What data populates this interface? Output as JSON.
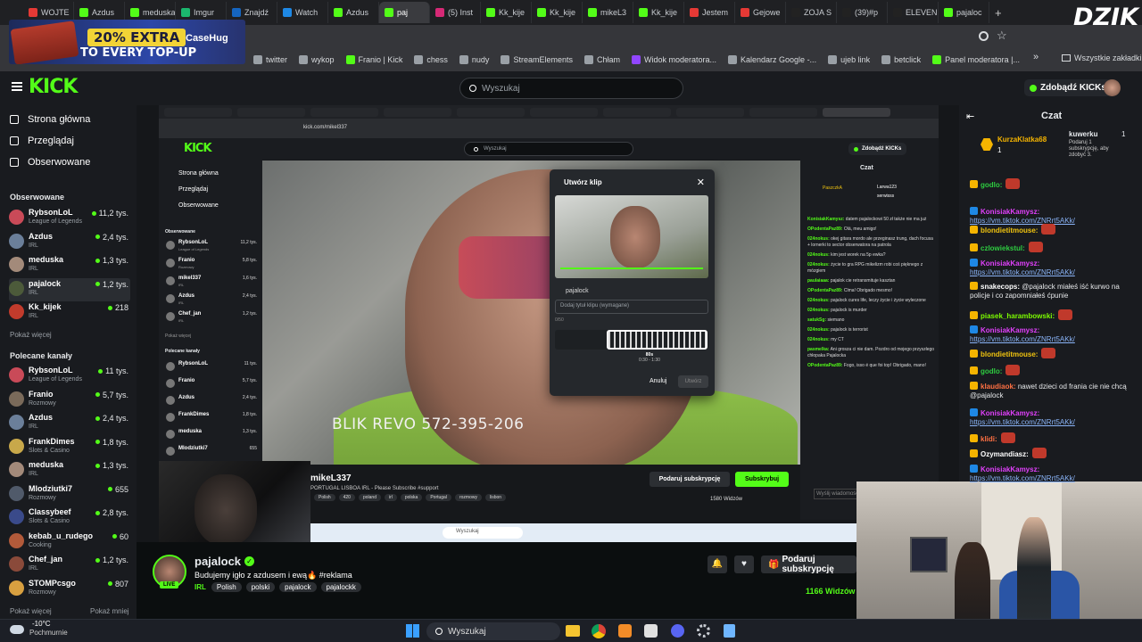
{
  "browser": {
    "tabs": [
      {
        "label": "WOJTE",
        "color": "#e53935"
      },
      {
        "label": "Azdus",
        "color": "#53fc18"
      },
      {
        "label": "meduska",
        "color": "#53fc18"
      },
      {
        "label": "Imgur",
        "color": "#1bb76e"
      },
      {
        "label": "Znajdź",
        "color": "#1565c0"
      },
      {
        "label": "Watch",
        "color": "#1e88e5"
      },
      {
        "label": "Azdus",
        "color": "#53fc18"
      },
      {
        "label": "paj",
        "color": "#53fc18",
        "active": true
      },
      {
        "label": "(5) Inst",
        "color": "#d62976"
      },
      {
        "label": "Kk_kije",
        "color": "#53fc18"
      },
      {
        "label": "Kk_kije",
        "color": "#53fc18"
      },
      {
        "label": "mikeL3",
        "color": "#53fc18"
      },
      {
        "label": "Kk_kije",
        "color": "#53fc18"
      },
      {
        "label": "Jestem",
        "color": "#e53935"
      },
      {
        "label": "Gejowe",
        "color": "#e53935"
      },
      {
        "label": "ZOJA S",
        "color": "#222222"
      },
      {
        "label": "(39)#p",
        "color": "#222222"
      },
      {
        "label": "ELEVEN",
        "color": "#222222"
      },
      {
        "label": "pajaloc",
        "color": "#53fc18"
      }
    ],
    "bookmarks": [
      {
        "label": "twitter",
        "icon": "x-icon"
      },
      {
        "label": "wykop",
        "icon": "wykop-icon"
      },
      {
        "label": "Franio | Kick",
        "icon": "kick-icon"
      },
      {
        "label": "chess",
        "icon": "chess-icon"
      },
      {
        "label": "nudy",
        "icon": "folder-icon"
      },
      {
        "label": "StreamElements",
        "icon": "streamelements-icon"
      },
      {
        "label": "Chłam",
        "icon": "globe-icon"
      },
      {
        "label": "Widok moderatora...",
        "icon": "twitch-icon"
      },
      {
        "label": "Kalendarz Google -...",
        "icon": "calendar-icon"
      },
      {
        "label": "ujeb link",
        "icon": "globe-icon"
      },
      {
        "label": "betclick",
        "icon": "globe-icon"
      },
      {
        "label": "Panel moderatora |...",
        "icon": "kick-icon"
      }
    ],
    "all_bookmarks": "Wszystkie zakładki",
    "ad": {
      "line1": "20% EXTRA",
      "line2": "TO EVERY TOP-UP",
      "brand": "CaseHug"
    },
    "overlay_brand": "DZIK"
  },
  "kick": {
    "search_placeholder": "Wyszukaj",
    "get_kicks": "Zdobądź KICKs",
    "nav": [
      {
        "label": "Strona główna",
        "icon": "home-icon"
      },
      {
        "label": "Przeglądaj",
        "icon": "browse-icon"
      },
      {
        "label": "Obserwowane",
        "icon": "heart-icon"
      }
    ],
    "followed_title": "Obserwowane",
    "followed": [
      {
        "name": "RybsonLoL",
        "cat": "League of Legends",
        "viewers": "11,2 tys.",
        "color": "#c94a58"
      },
      {
        "name": "Azdus",
        "cat": "IRL",
        "viewers": "2,4 tys.",
        "color": "#6b7f9a"
      },
      {
        "name": "meduska",
        "cat": "IRL",
        "viewers": "1,3 tys.",
        "color": "#a38a7a"
      },
      {
        "name": "pajalock",
        "cat": "IRL",
        "viewers": "1,2 tys.",
        "color": "#4c5a3a",
        "active": true
      },
      {
        "name": "Kk_kijek",
        "cat": "IRL",
        "viewers": "218",
        "color": "#c23b2c"
      }
    ],
    "show_more": "Pokaż więcej",
    "recommended_title": "Polecane kanały",
    "recommended": [
      {
        "name": "RybsonLoL",
        "cat": "League of Legends",
        "viewers": "11 tys.",
        "color": "#c94a58"
      },
      {
        "name": "Franio",
        "cat": "Rozmowy",
        "viewers": "5,7 tys.",
        "color": "#7a6a5a"
      },
      {
        "name": "Azdus",
        "cat": "IRL",
        "viewers": "2,4 tys.",
        "color": "#6b7f9a"
      },
      {
        "name": "FrankDimes",
        "cat": "Slots & Casino",
        "viewers": "1,8 tys.",
        "color": "#c8a84a"
      },
      {
        "name": "meduska",
        "cat": "IRL",
        "viewers": "1,3 tys.",
        "color": "#a38a7a"
      },
      {
        "name": "Mlodziutki7",
        "cat": "Rozmowy",
        "viewers": "655",
        "color": "#505a6a"
      },
      {
        "name": "Classybeef",
        "cat": "Slots & Casino",
        "viewers": "2,8 tys.",
        "color": "#3a4a8a"
      },
      {
        "name": "kebab_u_rudego",
        "cat": "Cooking",
        "viewers": "60",
        "color": "#b25a3a"
      },
      {
        "name": "Chef_jan",
        "cat": "IRL",
        "viewers": "1,2 tys.",
        "color": "#8a4a3a"
      },
      {
        "name": "STOMPcsgo",
        "cat": "Rozmowy",
        "viewers": "807",
        "color": "#d8a040"
      }
    ],
    "show_more2": "Pokaż więcej",
    "show_less": "Pokaż mniej",
    "stream": {
      "streamer": "pajalock",
      "title": "Budujemy igło z azdusem i ewą🔥 #reklama",
      "category": "IRL",
      "tags": [
        "Polish",
        "polski",
        "pajalock",
        "pajalockk"
      ],
      "subscribe": "Podaruj subskrypcję",
      "viewers": "1166 Widzów",
      "live": "LIVE"
    },
    "chat": {
      "title": "Czat",
      "pinned_user": "KurzaKlatka68",
      "pinned_count": "1",
      "gift_user": "kuwerku",
      "gift_count": "1",
      "gift_text": "Podaruj 1 subskrypcję, aby zdobyć 3.",
      "messages": [
        {
          "user": "godlo:",
          "text": "",
          "color": "#2ecc40"
        },
        {
          "user": "KonisiakKamysz:",
          "text": "https://vm.tiktok.com/ZNRrt5AKk/",
          "color": "#e040fb",
          "link": true
        },
        {
          "user": "blondietitmouse:",
          "text": "",
          "color": "#f1c40f"
        },
        {
          "user": "czlowiekstul:",
          "text": "",
          "color": "#2ecc40"
        },
        {
          "user": "KonisiakKamysz:",
          "text": "https://vm.tiktok.com/ZNRrt5AKk/",
          "color": "#e040fb",
          "link": true
        },
        {
          "user": "snakecops:",
          "text": "@pajalock miałeś iść kurwo na policje i co zapomniałeś ćpunie",
          "color": "#ffffff"
        },
        {
          "user": "piasek_harambowski:",
          "text": "",
          "color": "#7cfc00"
        },
        {
          "user": "KonisiakKamysz:",
          "text": "https://vm.tiktok.com/ZNRrt5AKk/",
          "color": "#e040fb",
          "link": true
        },
        {
          "user": "blondietitmouse:",
          "text": "",
          "color": "#f1c40f"
        },
        {
          "user": "godlo:",
          "text": "",
          "color": "#2ecc40"
        },
        {
          "user": "klaudiaok:",
          "text": "nawet dzieci od frania cie nie chcą @pajalock",
          "color": "#ff7043"
        },
        {
          "user": "KonisiakKamysz:",
          "text": "https://vm.tiktok.com/ZNRrt5AKk/",
          "color": "#e040fb",
          "link": true
        },
        {
          "user": "klidi:",
          "text": "",
          "color": "#ff7043"
        },
        {
          "user": "Ozymandiasz:",
          "text": "",
          "color": "#ffffff"
        },
        {
          "user": "KonisiakKamysz:",
          "text": "https://vm.tiktok.com/ZNRrt5AKk/",
          "color": "#e040fb",
          "link": true
        }
      ]
    }
  },
  "inner": {
    "url": "kick.com/mikel337",
    "search": "Wyszukaj",
    "kicks": "Zdobądź KICKs",
    "nav": [
      "Strona główna",
      "Przeglądaj",
      "Obserwowane"
    ],
    "followed_title": "Obserwowane",
    "followed": [
      {
        "name": "RybsonLoL",
        "cat": "League of Legends",
        "viewers": "11,2 tys."
      },
      {
        "name": "Franio",
        "cat": "Rozmowy",
        "viewers": "5,8 tys."
      },
      {
        "name": "mikel337",
        "cat": "IRL",
        "viewers": "1,6 tys."
      },
      {
        "name": "Azdus",
        "cat": "IRL",
        "viewers": "2,4 tys."
      },
      {
        "name": "Chef_jan",
        "cat": "IRL",
        "viewers": "1,2 tys."
      }
    ],
    "show_more": "Pokaż więcej",
    "rec_title": "Polecane kanały",
    "recommended": [
      {
        "name": "RybsonLoL",
        "viewers": "11 tys."
      },
      {
        "name": "Franio",
        "viewers": "5,7 tys."
      },
      {
        "name": "Azdus",
        "viewers": "2,4 tys."
      },
      {
        "name": "FrankDimes",
        "viewers": "1,8 tys."
      },
      {
        "name": "meduska",
        "viewers": "1,3 tys."
      },
      {
        "name": "Mlodziutki7",
        "viewers": "655"
      }
    ],
    "video_caption": "BLIK REVO  572-395-206",
    "clip": {
      "title": "Utwórz klip",
      "user": "pajalock",
      "placeholder": "Dodaj tytuł klipu (wymagane)",
      "counter": "0/50",
      "duration": "80s",
      "range": "0:30 - 1:30",
      "cancel": "Anuluj",
      "confirm": "Utwórz"
    },
    "streamer": "mikeL337",
    "stream_desc": "PORTUGAL LISBOA IRL - Please Subscribe #support",
    "tags": [
      "Polish",
      "420",
      "poland",
      "irl",
      "polska",
      "Portugal",
      "rozmowy",
      "lisbon"
    ],
    "gift": "Podaruj subskrypcję",
    "sub": "Subskrybuj",
    "viewers": "1580 Widzów",
    "chat_title": "Czat",
    "chat_lines": [
      {
        "user": "KonisiakKamysz:",
        "text": "datem pajalockowi 50 zł także nie ma już"
      },
      {
        "user": "OPodentaPaz89:",
        "text": "Olá, meu amigo!"
      },
      {
        "user": "024nokus:",
        "text": "okej gitara mordo ale przeginasz trung, dach focusa + lornerki to sector obserwatora na patrola"
      },
      {
        "user": "024nokus:",
        "text": "kim jest worek na 5p ewka?"
      },
      {
        "user": "024nokus:",
        "text": "życie to gra RPG mikelizm robi coś pięknego z mózgiem"
      },
      {
        "user": "paulaiaaa:",
        "text": "pajalok cie retransmituje kasztan"
      },
      {
        "user": "OPodentaPaz89:",
        "text": "Clma! Obrigado mesmo!"
      },
      {
        "user": "024nokus:",
        "text": "pajalock cures life, leczy życie i życie wyleczone"
      },
      {
        "user": "024nokus:",
        "text": "pajalock is murder"
      },
      {
        "user": "satukSg:",
        "text": "siemano"
      },
      {
        "user": "024nokus:",
        "text": "pajalock is terrorist"
      },
      {
        "user": "024nokus:",
        "text": "my CT"
      },
      {
        "user": "pasmelka:",
        "text": "Ani grosza ci nie dam. Pozdro od mojego przyszłego chłopaka Pajalocka"
      },
      {
        "user": "OPodentaPaz89:",
        "text": "Fogo, isso é que foi top! Obrigado, mano!"
      }
    ],
    "chat_input": "Wyślij wiadomość",
    "taskbar_search": "Wyszukaj",
    "pinned": "PaszczkA",
    "pinned2": "Larwa123",
    "pinned3": "serwisss"
  },
  "taskbar": {
    "weather_temp": "-10°C",
    "weather_desc": "Pochmurnie",
    "search": "Wyszukaj"
  }
}
